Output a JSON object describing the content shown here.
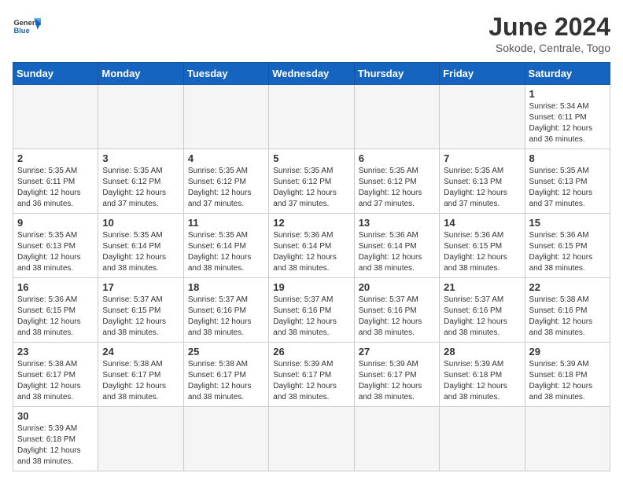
{
  "header": {
    "logo_general": "General",
    "logo_blue": "Blue",
    "month_title": "June 2024",
    "subtitle": "Sokode, Centrale, Togo"
  },
  "days_of_week": [
    "Sunday",
    "Monday",
    "Tuesday",
    "Wednesday",
    "Thursday",
    "Friday",
    "Saturday"
  ],
  "weeks": [
    [
      {
        "day": "",
        "info": ""
      },
      {
        "day": "",
        "info": ""
      },
      {
        "day": "",
        "info": ""
      },
      {
        "day": "",
        "info": ""
      },
      {
        "day": "",
        "info": ""
      },
      {
        "day": "",
        "info": ""
      },
      {
        "day": "1",
        "info": "Sunrise: 5:34 AM\nSunset: 6:11 PM\nDaylight: 12 hours and 36 minutes."
      }
    ],
    [
      {
        "day": "2",
        "info": "Sunrise: 5:35 AM\nSunset: 6:11 PM\nDaylight: 12 hours and 36 minutes."
      },
      {
        "day": "3",
        "info": "Sunrise: 5:35 AM\nSunset: 6:12 PM\nDaylight: 12 hours and 37 minutes."
      },
      {
        "day": "4",
        "info": "Sunrise: 5:35 AM\nSunset: 6:12 PM\nDaylight: 12 hours and 37 minutes."
      },
      {
        "day": "5",
        "info": "Sunrise: 5:35 AM\nSunset: 6:12 PM\nDaylight: 12 hours and 37 minutes."
      },
      {
        "day": "6",
        "info": "Sunrise: 5:35 AM\nSunset: 6:12 PM\nDaylight: 12 hours and 37 minutes."
      },
      {
        "day": "7",
        "info": "Sunrise: 5:35 AM\nSunset: 6:13 PM\nDaylight: 12 hours and 37 minutes."
      },
      {
        "day": "8",
        "info": "Sunrise: 5:35 AM\nSunset: 6:13 PM\nDaylight: 12 hours and 37 minutes."
      }
    ],
    [
      {
        "day": "9",
        "info": "Sunrise: 5:35 AM\nSunset: 6:13 PM\nDaylight: 12 hours and 38 minutes."
      },
      {
        "day": "10",
        "info": "Sunrise: 5:35 AM\nSunset: 6:14 PM\nDaylight: 12 hours and 38 minutes."
      },
      {
        "day": "11",
        "info": "Sunrise: 5:35 AM\nSunset: 6:14 PM\nDaylight: 12 hours and 38 minutes."
      },
      {
        "day": "12",
        "info": "Sunrise: 5:36 AM\nSunset: 6:14 PM\nDaylight: 12 hours and 38 minutes."
      },
      {
        "day": "13",
        "info": "Sunrise: 5:36 AM\nSunset: 6:14 PM\nDaylight: 12 hours and 38 minutes."
      },
      {
        "day": "14",
        "info": "Sunrise: 5:36 AM\nSunset: 6:15 PM\nDaylight: 12 hours and 38 minutes."
      },
      {
        "day": "15",
        "info": "Sunrise: 5:36 AM\nSunset: 6:15 PM\nDaylight: 12 hours and 38 minutes."
      }
    ],
    [
      {
        "day": "16",
        "info": "Sunrise: 5:36 AM\nSunset: 6:15 PM\nDaylight: 12 hours and 38 minutes."
      },
      {
        "day": "17",
        "info": "Sunrise: 5:37 AM\nSunset: 6:15 PM\nDaylight: 12 hours and 38 minutes."
      },
      {
        "day": "18",
        "info": "Sunrise: 5:37 AM\nSunset: 6:16 PM\nDaylight: 12 hours and 38 minutes."
      },
      {
        "day": "19",
        "info": "Sunrise: 5:37 AM\nSunset: 6:16 PM\nDaylight: 12 hours and 38 minutes."
      },
      {
        "day": "20",
        "info": "Sunrise: 5:37 AM\nSunset: 6:16 PM\nDaylight: 12 hours and 38 minutes."
      },
      {
        "day": "21",
        "info": "Sunrise: 5:37 AM\nSunset: 6:16 PM\nDaylight: 12 hours and 38 minutes."
      },
      {
        "day": "22",
        "info": "Sunrise: 5:38 AM\nSunset: 6:16 PM\nDaylight: 12 hours and 38 minutes."
      }
    ],
    [
      {
        "day": "23",
        "info": "Sunrise: 5:38 AM\nSunset: 6:17 PM\nDaylight: 12 hours and 38 minutes."
      },
      {
        "day": "24",
        "info": "Sunrise: 5:38 AM\nSunset: 6:17 PM\nDaylight: 12 hours and 38 minutes."
      },
      {
        "day": "25",
        "info": "Sunrise: 5:38 AM\nSunset: 6:17 PM\nDaylight: 12 hours and 38 minutes."
      },
      {
        "day": "26",
        "info": "Sunrise: 5:39 AM\nSunset: 6:17 PM\nDaylight: 12 hours and 38 minutes."
      },
      {
        "day": "27",
        "info": "Sunrise: 5:39 AM\nSunset: 6:17 PM\nDaylight: 12 hours and 38 minutes."
      },
      {
        "day": "28",
        "info": "Sunrise: 5:39 AM\nSunset: 6:18 PM\nDaylight: 12 hours and 38 minutes."
      },
      {
        "day": "29",
        "info": "Sunrise: 5:39 AM\nSunset: 6:18 PM\nDaylight: 12 hours and 38 minutes."
      }
    ],
    [
      {
        "day": "30",
        "info": "Sunrise: 5:39 AM\nSunset: 6:18 PM\nDaylight: 12 hours and 38 minutes."
      },
      {
        "day": "",
        "info": ""
      },
      {
        "day": "",
        "info": ""
      },
      {
        "day": "",
        "info": ""
      },
      {
        "day": "",
        "info": ""
      },
      {
        "day": "",
        "info": ""
      },
      {
        "day": "",
        "info": ""
      }
    ]
  ]
}
